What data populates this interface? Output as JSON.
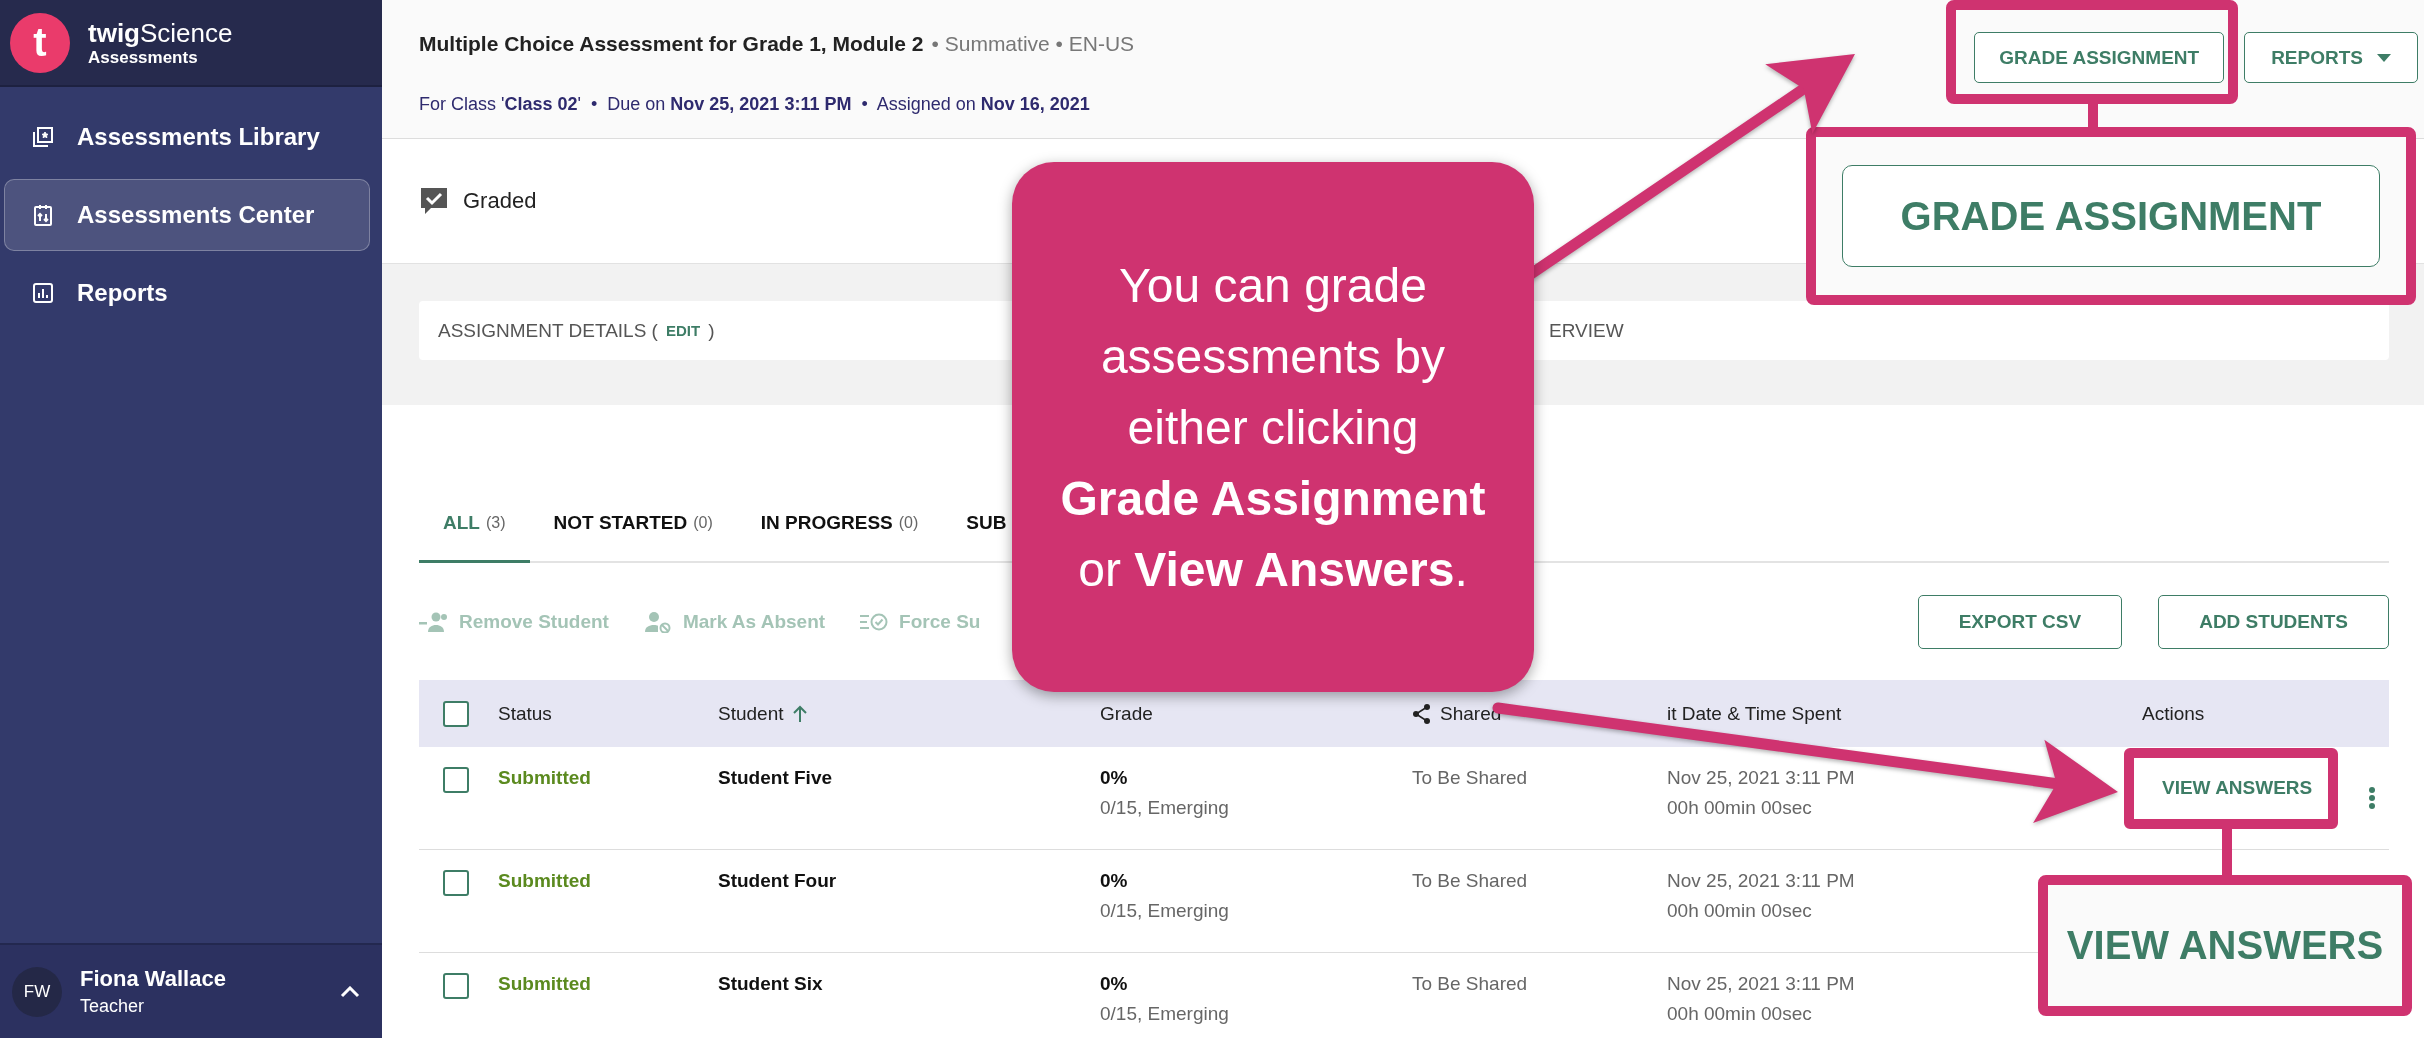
{
  "sidebar": {
    "brand": {
      "logo_letter": "t",
      "wordmark_bold": "twig",
      "wordmark_light": "Science",
      "subtitle": "Assessments"
    },
    "nav": [
      {
        "label": "Assessments Library",
        "kind": "library",
        "selected": false
      },
      {
        "label": "Assessments Center",
        "kind": "center",
        "selected": true
      },
      {
        "label": "Reports",
        "kind": "reports",
        "selected": false
      }
    ],
    "user": {
      "initials": "FW",
      "name": "Fiona Wallace",
      "role": "Teacher"
    }
  },
  "header": {
    "title": "Multiple Choice Assessment for Grade 1, Module 2",
    "meta": "• Summative • EN-US",
    "details": "For Class '**Class 02**'  •  Due on **Nov 25, 2021 3:11 PM**  •  Assigned on **Nov 16, 2021**",
    "buttons": [
      {
        "label": "GRADE ASSIGNMENT",
        "kind": "plain"
      },
      {
        "label": "REPORTS",
        "kind": "dropdown"
      }
    ]
  },
  "graded_label": "Graded",
  "details_card": {
    "left_label": "ASSIGNMENT DETAILS (",
    "edit_link": "EDIT",
    "left_close": ")",
    "right_label": "ERVIEW"
  },
  "tabs": [
    {
      "label": "ALL",
      "count": "(3)",
      "selected": true
    },
    {
      "label": "NOT STARTED",
      "count": "(0)",
      "selected": false
    },
    {
      "label": "IN PROGRESS",
      "count": "(0)",
      "selected": false
    },
    {
      "label": "SUB",
      "selected": false
    }
  ],
  "actions": [
    {
      "label": "Remove Student",
      "kind": "remove",
      "disabled": true
    },
    {
      "label": "Mark As Absent",
      "kind": "absent",
      "disabled": true
    },
    {
      "label": "Force Su",
      "kind": "force",
      "disabled": true
    }
  ],
  "table_buttons": [
    "EXPORT CSV",
    "ADD STUDENTS"
  ],
  "table": {
    "select_all_checked": false,
    "columns": [
      {
        "label": "Status",
        "kind": "plain",
        "sorted": false
      },
      {
        "label": "Student",
        "kind": "plain",
        "sorted": true
      },
      {
        "label": "Grade",
        "kind": "plain",
        "sorted": false
      },
      {
        "label": "Shared",
        "kind": "shared",
        "sorted": false
      },
      {
        "label": "it Date & Time Spent",
        "kind": "plain",
        "sorted": false
      },
      {
        "label": "Actions",
        "kind": "plain",
        "sorted": false
      }
    ],
    "rows": [
      {
        "checked": false,
        "status": "Submitted",
        "student": "Student Five",
        "grade": "0%",
        "grade_detail": "0/15, Emerging",
        "shared": "To Be Shared",
        "date": "Nov 25, 2021 3:11 PM",
        "time_spent": "00h 00min 00sec",
        "action": "VIEW ANSWERS"
      },
      {
        "checked": false,
        "status": "Submitted",
        "student": "Student Four",
        "grade": "0%",
        "grade_detail": "0/15, Emerging",
        "shared": "To Be Shared",
        "date": "Nov 25, 2021 3:11 PM",
        "time_spent": "00h 00min 00sec"
      },
      {
        "checked": false,
        "status": "Submitted",
        "student": "Student Six",
        "grade": "0%",
        "grade_detail": "0/15, Emerging",
        "shared": "To Be Shared",
        "date": "Nov 25, 2021 3:11 PM",
        "time_spent": "00h 00min 00sec"
      }
    ]
  },
  "tutorial": {
    "callout": "You can grade assessments by either clicking **Grade Assignment** or **View Answers**.",
    "insets": [
      "GRADE ASSIGNMENT",
      "VIEW ANSWERS"
    ]
  }
}
